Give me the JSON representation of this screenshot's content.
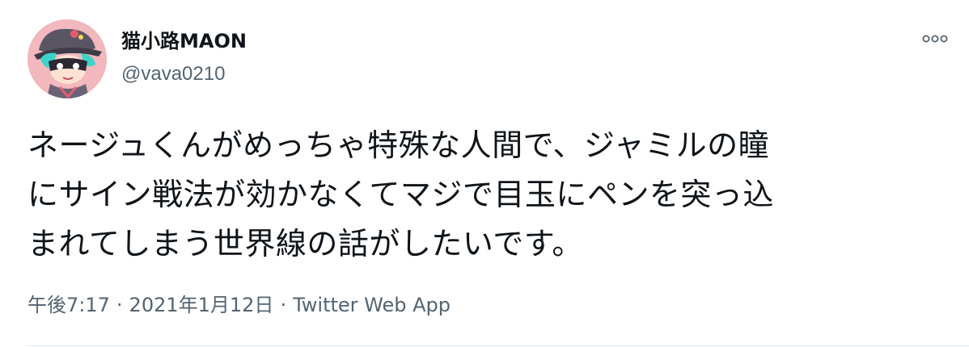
{
  "tweet": {
    "display_name": "猫小路MAON",
    "handle": "@vava0210",
    "text_lines": [
      "ネージュくんがめっちゃ特殊な人間で、ジャミルの瞳",
      "にサイン戦法が効かなくてマジで目玉にペンを突っ込",
      "まれてしまう世界線の話がしたいです。"
    ],
    "time": "午後7:17",
    "separator": "·",
    "date": "2021年1月12日",
    "source": "Twitter Web App"
  },
  "icons": {
    "more": "more-horizontal-icon",
    "avatar": "profile-avatar"
  },
  "colors": {
    "text_primary": "#0f1419",
    "text_secondary": "#536471",
    "avatar_bg": "#f2b8bd",
    "divider": "#e1e8ed"
  }
}
